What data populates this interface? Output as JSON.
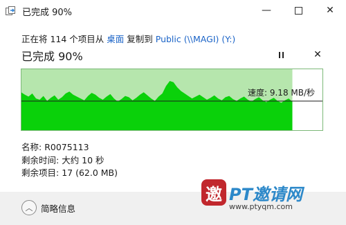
{
  "window": {
    "title": "已完成 90%",
    "icon": "copy-files-icon",
    "minimize_glyph": "—",
    "close_glyph": "✕"
  },
  "copy_line": {
    "prefix": "正在将 114 个项目从 ",
    "source": "桌面",
    "middle": " 复制到 ",
    "destination": "Public (\\\\MAGI) (Y:)"
  },
  "progress": {
    "status": "已完成 90%",
    "percent": 90,
    "cancel_glyph": "✕"
  },
  "graph": {
    "speed_label": "速度: 9.18 MB/秒",
    "colors": {
      "fill": "#0ad10a",
      "background": "#b6e6ad",
      "line": "#1a1a1a",
      "border": "#7cb878"
    }
  },
  "details": {
    "name_label": "名称:",
    "name_value": "R0075113",
    "time_label": "剩余时间:",
    "time_value": "大约 10 秒",
    "items_label": "剩余项目:",
    "items_value": "17 (62.0 MB)"
  },
  "footer": {
    "chevron": "︿",
    "label": "简略信息"
  },
  "watermark": {
    "logo_char": "邀",
    "name": "PT邀请网",
    "url": "www.ptyqm.com"
  }
}
